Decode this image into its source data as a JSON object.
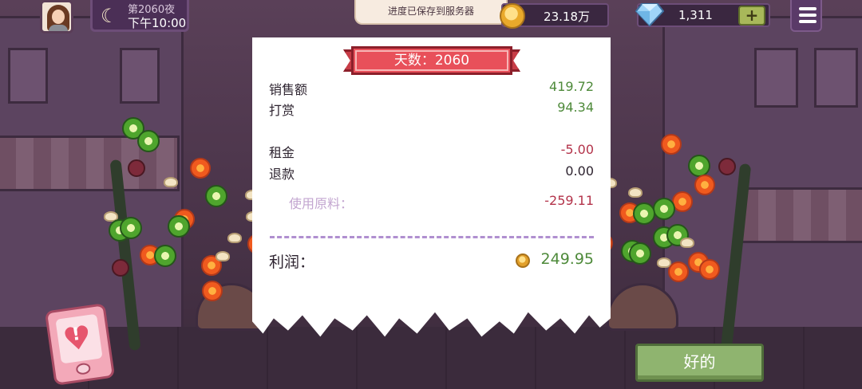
{
  "top_bar": {
    "night_label": "第2060夜",
    "time_label": "下午10:00",
    "toast": "进度已保存到服务器",
    "coins": "23.18万",
    "gems": "1,311",
    "plus_label": "+"
  },
  "receipt": {
    "day_banner": "天数：2060",
    "rows": [
      {
        "label": "销售额",
        "value": "419.72"
      },
      {
        "label": "打赏",
        "value": "94.34"
      },
      {
        "label": "租金",
        "value": "-5.00"
      },
      {
        "label": "退款",
        "value": "0.00"
      },
      {
        "label": "使用原料：",
        "value": "-259.11"
      }
    ],
    "profit_label": "利润：",
    "profit_value": "249.95"
  },
  "ok_button": "好的",
  "icons": {
    "moon": "moon-icon",
    "coin": "coin-icon",
    "gem": "diamond-icon",
    "menu": "hamburger-menu-icon",
    "phone": "phone-alert-icon"
  },
  "colors": {
    "positive": "#4e8a3a",
    "negative": "#b3334a",
    "banner": "#e8505a",
    "ok_button": "#8fb46f"
  }
}
